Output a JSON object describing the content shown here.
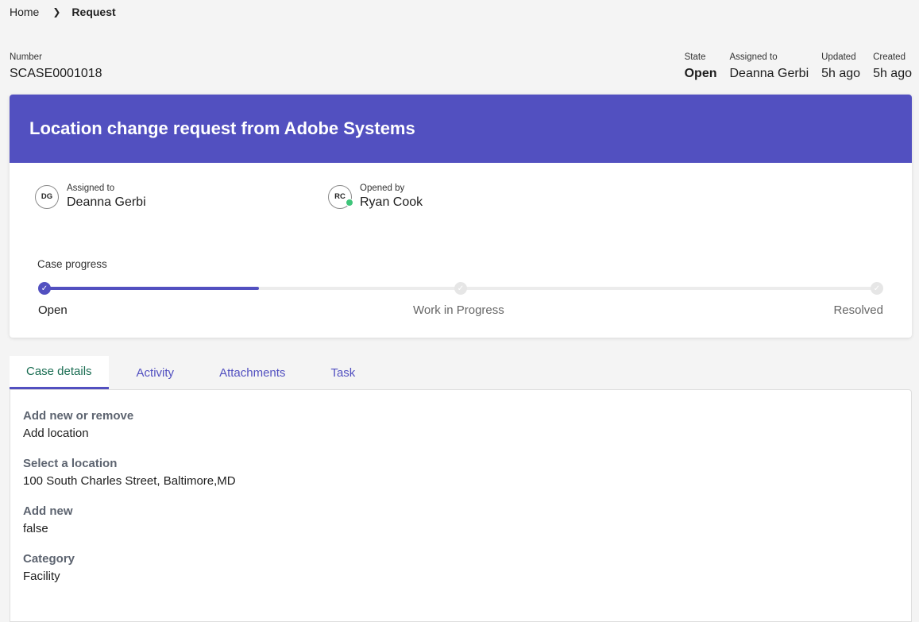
{
  "breadcrumb": {
    "home": "Home",
    "separator_icon": "chevron-right-icon",
    "current": "Request"
  },
  "record": {
    "number_label": "Number",
    "number": "SCASE0001018"
  },
  "meta": {
    "state_label": "State",
    "state": "Open",
    "assigned_label": "Assigned to",
    "assigned": "Deanna Gerbi",
    "updated_label": "Updated",
    "updated": "5h ago",
    "created_label": "Created",
    "created": "5h ago"
  },
  "case": {
    "title": "Location change request from Adobe Systems",
    "assigned_label": "Assigned to",
    "assigned_initials": "DG",
    "assigned_name": "Deanna Gerbi",
    "opened_label": "Opened by",
    "opened_initials": "RC",
    "opened_name": "Ryan Cook",
    "opened_presence": "online"
  },
  "progress": {
    "label": "Case progress",
    "fill_fraction": 0.26,
    "steps": [
      {
        "label": "Open",
        "status": "done"
      },
      {
        "label": "Work in Progress",
        "status": "pending"
      },
      {
        "label": "Resolved",
        "status": "pending"
      }
    ]
  },
  "tabs": [
    {
      "label": "Case details",
      "active": true
    },
    {
      "label": "Activity",
      "active": false
    },
    {
      "label": "Attachments",
      "active": false
    },
    {
      "label": "Task",
      "active": false
    }
  ],
  "details": [
    {
      "label": "Add new or remove",
      "value": "Add location"
    },
    {
      "label": "Select a location",
      "value": "100 South Charles Street, Baltimore,MD"
    },
    {
      "label": "Add new",
      "value": "false"
    },
    {
      "label": "Category",
      "value": "Facility"
    }
  ],
  "colors": {
    "accent": "#5250c0",
    "active_tab_text": "#1a6d52",
    "presence": "#3fc57a",
    "background": "#f4f4f4"
  }
}
